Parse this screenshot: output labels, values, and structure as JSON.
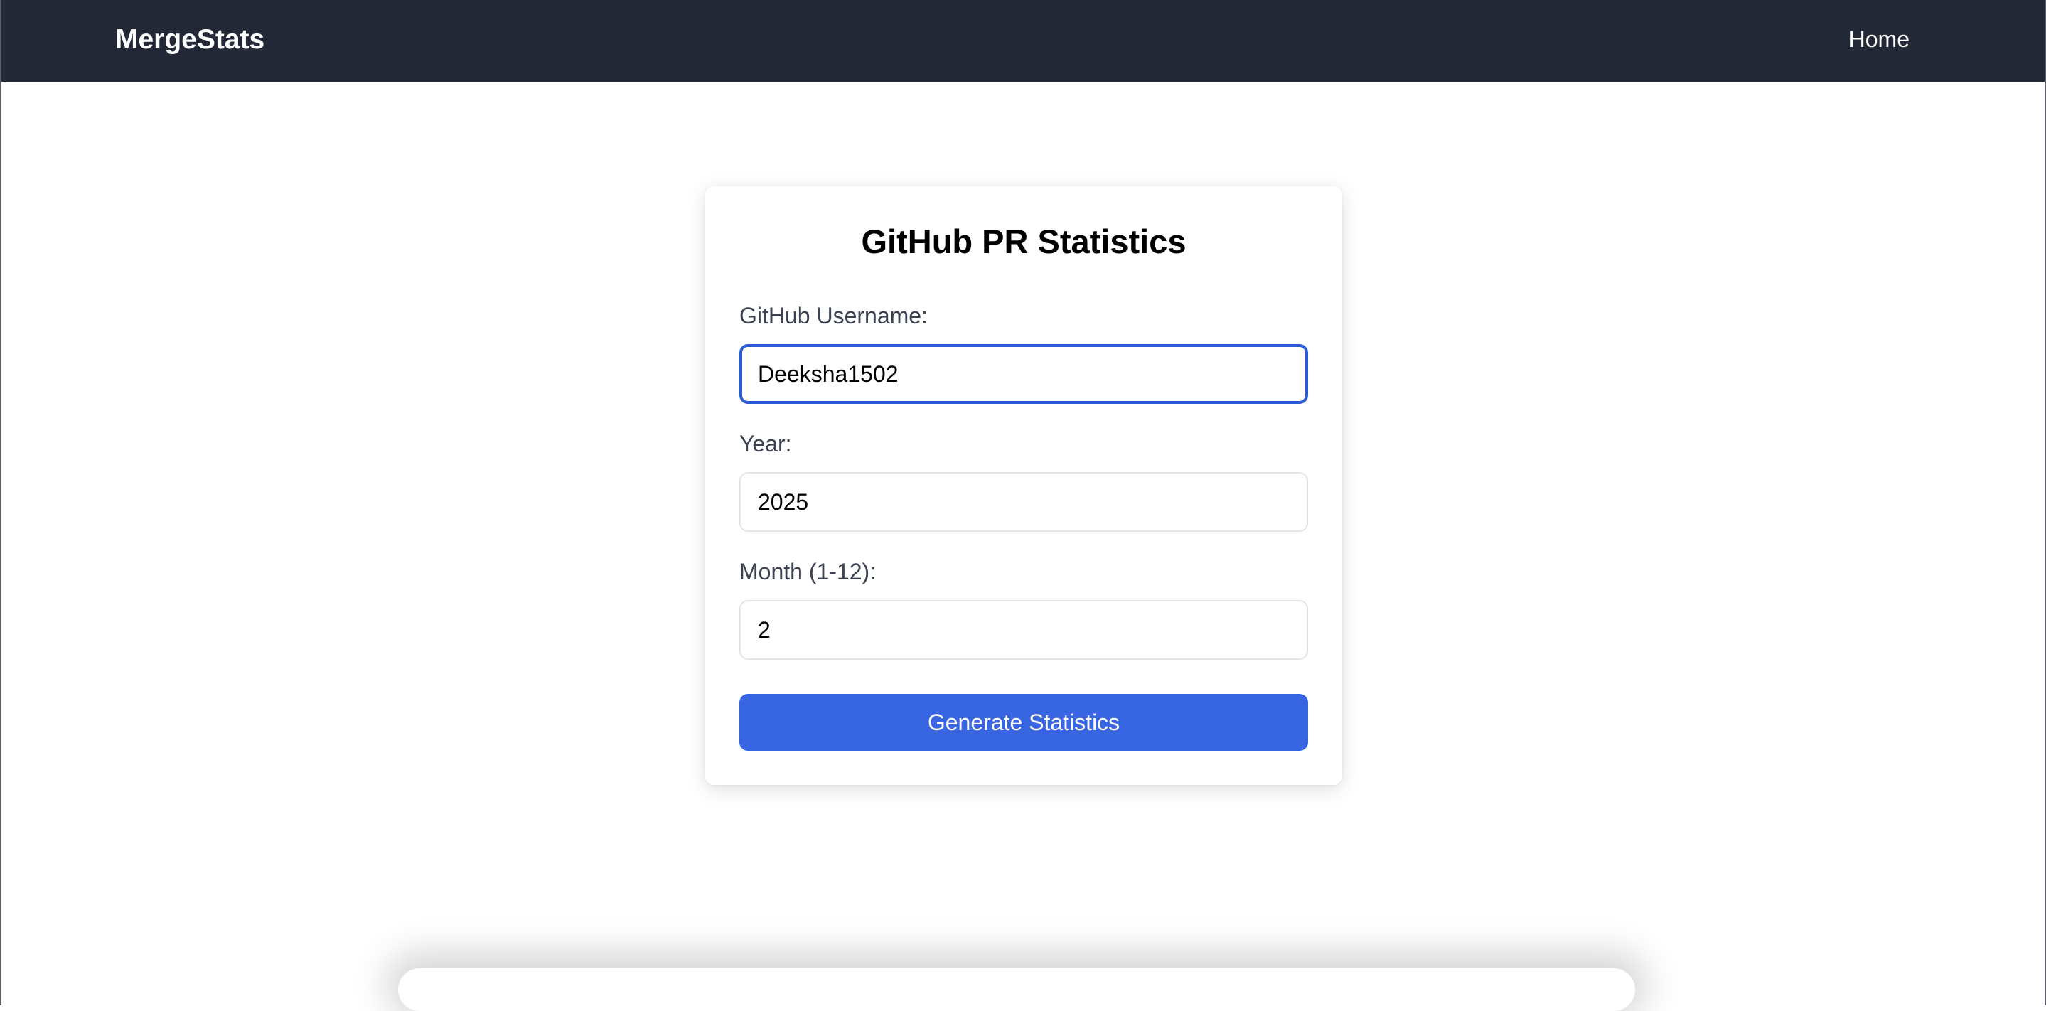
{
  "navbar": {
    "brand": "MergeStats",
    "links": [
      {
        "label": "Home"
      }
    ]
  },
  "form": {
    "title": "GitHub PR Statistics",
    "fields": {
      "username": {
        "label": "GitHub Username:",
        "value": "Deeksha1502"
      },
      "year": {
        "label": "Year:",
        "value": "2025"
      },
      "month": {
        "label": "Month (1-12):",
        "value": "2"
      }
    },
    "submit_label": "Generate Statistics"
  },
  "colors": {
    "navbar_bg": "#222836",
    "accent": "#3865e2",
    "focus_border": "#2a5bd7"
  }
}
